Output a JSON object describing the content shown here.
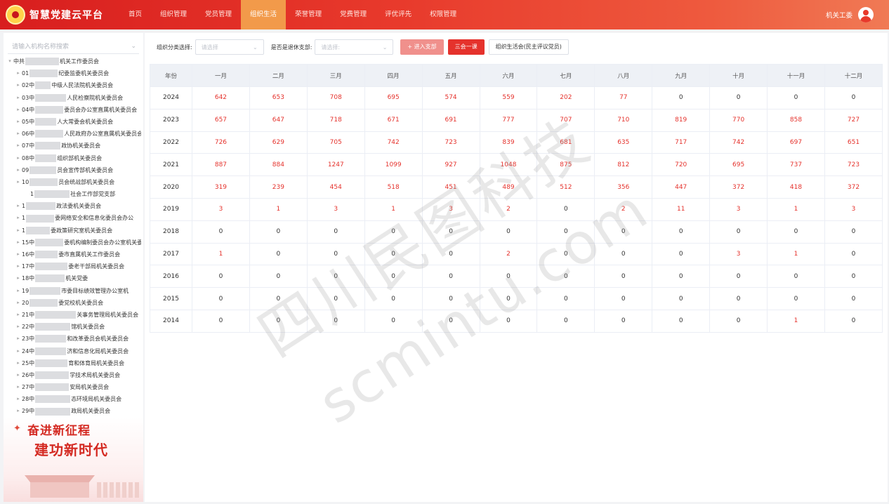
{
  "app": {
    "title": "智慧党建云平台",
    "logo_icon": "party-emblem-icon"
  },
  "nav": {
    "items": [
      "首页",
      "组织管理",
      "党员管理",
      "组织生活",
      "荣誉管理",
      "党费管理",
      "评优评先",
      "权限管理"
    ],
    "active": "组织生活"
  },
  "user": {
    "name": "机关工委",
    "icon": "user-avatar-icon"
  },
  "sidebar": {
    "search_placeholder": "请输入机构名称搜索",
    "tree": [
      {
        "prefix": "中共",
        "suffix": "机关工作委员会",
        "level": 0
      },
      {
        "prefix": "01",
        "suffix": "纪委监委机关委员会",
        "level": 1
      },
      {
        "prefix": "02中",
        "suffix": "中级人民法院机关委员会",
        "level": 1
      },
      {
        "prefix": "03中",
        "suffix": "人民检察院机关委员会",
        "level": 1
      },
      {
        "prefix": "04中",
        "suffix": "委员会办公室直属机关委员会",
        "level": 1
      },
      {
        "prefix": "05中",
        "suffix": "人大常委会机关委员会",
        "level": 1
      },
      {
        "prefix": "06中",
        "suffix": "人民政府办公室直属机关委员会",
        "level": 1
      },
      {
        "prefix": "07中",
        "suffix": "政协机关委员会",
        "level": 1
      },
      {
        "prefix": "08中",
        "suffix": "组织部机关委员会",
        "level": 1
      },
      {
        "prefix": "09",
        "suffix": "员会宣传部机关委员会",
        "level": 1
      },
      {
        "prefix": "10",
        "suffix": "员会统战部机关委员会",
        "level": 1
      },
      {
        "prefix": "1",
        "suffix": "社会工作部党支部",
        "level": 2
      },
      {
        "prefix": "1",
        "suffix": "政法委机关委员会",
        "level": 1
      },
      {
        "prefix": "1",
        "suffix": "委网络安全和信息化委员会办公",
        "level": 1
      },
      {
        "prefix": "1",
        "suffix": "委政策研究室机关委员会",
        "level": 1
      },
      {
        "prefix": "15中",
        "suffix": "委机构编制委员会办公室机关委",
        "level": 1
      },
      {
        "prefix": "16中",
        "suffix": "委市直属机关工作委员会",
        "level": 1
      },
      {
        "prefix": "17中",
        "suffix": "委老干部局机关委员会",
        "level": 1
      },
      {
        "prefix": "18中",
        "suffix": "机关党委",
        "level": 1
      },
      {
        "prefix": "19",
        "suffix": "市委目标绩效管理办公室机",
        "level": 1
      },
      {
        "prefix": "20",
        "suffix": "委党校机关委员会",
        "level": 1
      },
      {
        "prefix": "21中",
        "suffix": "关事务管理局机关委员会",
        "level": 1
      },
      {
        "prefix": "22中",
        "suffix": "馆机关委员会",
        "level": 1
      },
      {
        "prefix": "23中",
        "suffix": "和改革委员会机关委员会",
        "level": 1
      },
      {
        "prefix": "24中",
        "suffix": "济和信息化局机关委员会",
        "level": 1
      },
      {
        "prefix": "25中",
        "suffix": "育和体育局机关委员会",
        "level": 1
      },
      {
        "prefix": "26中",
        "suffix": "学技术局机关委员会",
        "level": 1
      },
      {
        "prefix": "27中",
        "suffix": "安局机关委员会",
        "level": 1
      },
      {
        "prefix": "28中",
        "suffix": "态环境局机关委员会",
        "level": 1
      },
      {
        "prefix": "29中",
        "suffix": "政局机关委员会",
        "level": 1
      }
    ]
  },
  "promo": {
    "line1": "奋进新征程",
    "line2": "建功新时代"
  },
  "filters": {
    "category_label": "组织分类选择:",
    "category_placeholder": "请选择",
    "retired_label": "是否是退休支部:",
    "retired_placeholder": "请选择:",
    "btn_enter": "+ 进入支部",
    "btn_three": "三会一课",
    "btn_life": "组织生活会(民主评议党员)"
  },
  "table": {
    "headers": [
      "年份",
      "一月",
      "二月",
      "三月",
      "四月",
      "五月",
      "六月",
      "七月",
      "八月",
      "九月",
      "十月",
      "十一月",
      "十二月"
    ],
    "rows": [
      {
        "year": "2024",
        "values": [
          "642",
          "653",
          "708",
          "695",
          "574",
          "559",
          "202",
          "77",
          "0",
          "0",
          "0",
          "0"
        ]
      },
      {
        "year": "2023",
        "values": [
          "657",
          "647",
          "718",
          "671",
          "691",
          "777",
          "707",
          "710",
          "819",
          "770",
          "858",
          "727"
        ]
      },
      {
        "year": "2022",
        "values": [
          "726",
          "629",
          "705",
          "742",
          "723",
          "839",
          "681",
          "635",
          "717",
          "742",
          "697",
          "651"
        ]
      },
      {
        "year": "2021",
        "values": [
          "887",
          "884",
          "1247",
          "1099",
          "927",
          "1048",
          "875",
          "812",
          "720",
          "695",
          "737",
          "723"
        ]
      },
      {
        "year": "2020",
        "values": [
          "319",
          "239",
          "454",
          "518",
          "451",
          "489",
          "512",
          "356",
          "447",
          "372",
          "418",
          "372"
        ]
      },
      {
        "year": "2019",
        "values": [
          "3",
          "1",
          "3",
          "1",
          "3",
          "2",
          "0",
          "2",
          "11",
          "3",
          "1",
          "3"
        ]
      },
      {
        "year": "2018",
        "values": [
          "0",
          "0",
          "0",
          "0",
          "0",
          "0",
          "0",
          "0",
          "0",
          "0",
          "0",
          "0"
        ]
      },
      {
        "year": "2017",
        "values": [
          "1",
          "0",
          "0",
          "0",
          "0",
          "2",
          "0",
          "0",
          "0",
          "3",
          "1",
          "0"
        ]
      },
      {
        "year": "2016",
        "values": [
          "0",
          "0",
          "0",
          "0",
          "0",
          "0",
          "0",
          "0",
          "0",
          "0",
          "0",
          "0"
        ]
      },
      {
        "year": "2015",
        "values": [
          "0",
          "0",
          "0",
          "0",
          "0",
          "0",
          "0",
          "0",
          "0",
          "0",
          "0",
          "0"
        ]
      },
      {
        "year": "2014",
        "values": [
          "0",
          "0",
          "0",
          "0",
          "0",
          "0",
          "0",
          "0",
          "0",
          "0",
          "1",
          "0"
        ]
      }
    ]
  },
  "watermark": {
    "line1": "四川民图科技",
    "line2": "scmintu.com"
  },
  "colors": {
    "brand_red": "#e5322c",
    "nav_active": "#f29a4a",
    "table_header_bg": "#eef1f6"
  }
}
